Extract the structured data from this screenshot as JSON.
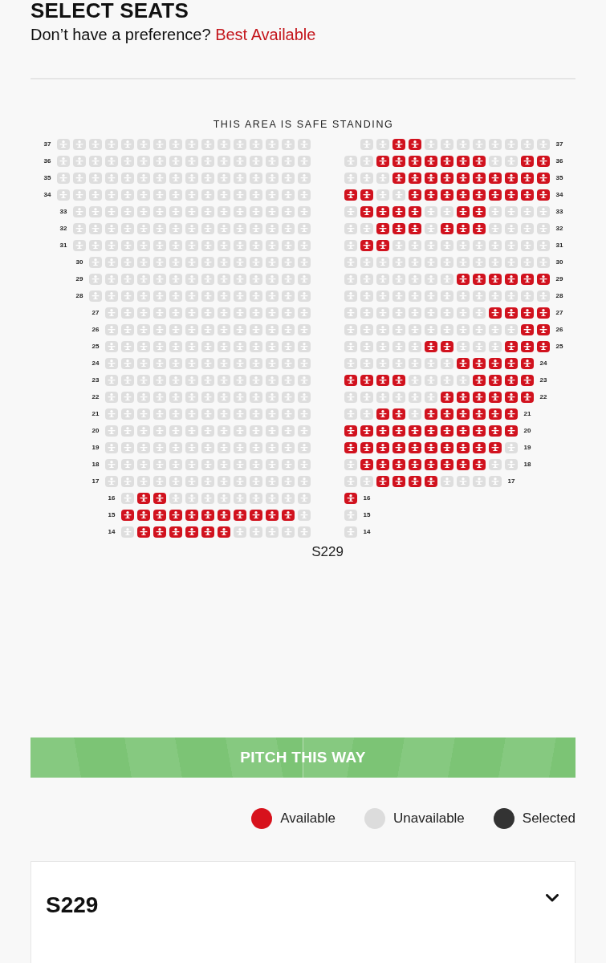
{
  "header": {
    "title": "SELECT SEATS",
    "prompt": "Don’t have a preference?",
    "link": "Best Available"
  },
  "seat_map": {
    "area_note": "THIS AREA IS SAFE STANDING",
    "section_label": "S229",
    "blocks": [
      {
        "kind": "left",
        "rows": [
          {
            "label": "37",
            "available": [
              false,
              false,
              false,
              false,
              false,
              false,
              false,
              false,
              false,
              false,
              false,
              false,
              false,
              false,
              false,
              false
            ]
          },
          {
            "label": "36",
            "available": [
              false,
              false,
              false,
              false,
              false,
              false,
              false,
              false,
              false,
              false,
              false,
              false,
              false,
              false,
              false,
              false
            ]
          },
          {
            "label": "35",
            "available": [
              false,
              false,
              false,
              false,
              false,
              false,
              false,
              false,
              false,
              false,
              false,
              false,
              false,
              false,
              false,
              false
            ]
          },
          {
            "label": "34",
            "available": [
              false,
              false,
              false,
              false,
              false,
              false,
              false,
              false,
              false,
              false,
              false,
              false,
              false,
              false,
              false,
              false
            ]
          },
          {
            "label": "33",
            "available": [
              false,
              false,
              false,
              false,
              false,
              false,
              false,
              false,
              false,
              false,
              false,
              false,
              false,
              false,
              false
            ]
          },
          {
            "label": "32",
            "available": [
              false,
              false,
              false,
              false,
              false,
              false,
              false,
              false,
              false,
              false,
              false,
              false,
              false,
              false,
              false
            ]
          },
          {
            "label": "31",
            "available": [
              false,
              false,
              false,
              false,
              false,
              false,
              false,
              false,
              false,
              false,
              false,
              false,
              false,
              false,
              false
            ]
          },
          {
            "label": "30",
            "available": [
              false,
              false,
              false,
              false,
              false,
              false,
              false,
              false,
              false,
              false,
              false,
              false,
              false,
              false
            ]
          },
          {
            "label": "29",
            "available": [
              false,
              false,
              false,
              false,
              false,
              false,
              false,
              false,
              false,
              false,
              false,
              false,
              false,
              false
            ]
          },
          {
            "label": "28",
            "available": [
              false,
              false,
              false,
              false,
              false,
              false,
              false,
              false,
              false,
              false,
              false,
              false,
              false,
              false
            ]
          },
          {
            "label": "27",
            "available": [
              false,
              false,
              false,
              false,
              false,
              false,
              false,
              false,
              false,
              false,
              false,
              false,
              false
            ]
          },
          {
            "label": "26",
            "available": [
              false,
              false,
              false,
              false,
              false,
              false,
              false,
              false,
              false,
              false,
              false,
              false,
              false
            ]
          },
          {
            "label": "25",
            "available": [
              false,
              false,
              false,
              false,
              false,
              false,
              false,
              false,
              false,
              false,
              false,
              false,
              false
            ]
          },
          {
            "label": "24",
            "available": [
              false,
              false,
              false,
              false,
              false,
              false,
              false,
              false,
              false,
              false,
              false,
              false,
              false
            ]
          },
          {
            "label": "23",
            "available": [
              false,
              false,
              false,
              false,
              false,
              false,
              false,
              false,
              false,
              false,
              false,
              false,
              false
            ]
          },
          {
            "label": "22",
            "available": [
              false,
              false,
              false,
              false,
              false,
              false,
              false,
              false,
              false,
              false,
              false,
              false,
              false
            ]
          },
          {
            "label": "21",
            "available": [
              false,
              false,
              false,
              false,
              false,
              false,
              false,
              false,
              false,
              false,
              false,
              false,
              false
            ]
          },
          {
            "label": "20",
            "available": [
              false,
              false,
              false,
              false,
              false,
              false,
              false,
              false,
              false,
              false,
              false,
              false,
              false
            ]
          },
          {
            "label": "19",
            "available": [
              false,
              false,
              false,
              false,
              false,
              false,
              false,
              false,
              false,
              false,
              false,
              false,
              false
            ]
          },
          {
            "label": "18",
            "available": [
              false,
              false,
              false,
              false,
              false,
              false,
              false,
              false,
              false,
              false,
              false,
              false,
              false
            ]
          },
          {
            "label": "17",
            "available": [
              false,
              false,
              false,
              false,
              false,
              false,
              false,
              false,
              false,
              false,
              false,
              false,
              false
            ]
          },
          {
            "label": "16",
            "available": [
              false,
              true,
              true,
              false,
              false,
              false,
              false,
              false,
              false,
              false,
              false,
              false
            ]
          },
          {
            "label": "15",
            "available": [
              true,
              true,
              true,
              true,
              true,
              true,
              true,
              true,
              true,
              true,
              true,
              false
            ]
          },
          {
            "label": "14",
            "available": [
              false,
              true,
              true,
              true,
              true,
              true,
              true,
              false,
              false,
              false,
              false,
              false
            ]
          }
        ]
      },
      {
        "kind": "right",
        "rows": [
          {
            "label": "37",
            "kind": "outer",
            "available": [
              false,
              false,
              true,
              true,
              false,
              false,
              false,
              false,
              false,
              false,
              false,
              false
            ]
          },
          {
            "label": "36",
            "kind": "aisle",
            "available": [
              false,
              false,
              true,
              true,
              true,
              true,
              true,
              true,
              true,
              false,
              false,
              true,
              true
            ]
          },
          {
            "label": "35",
            "kind": "aisle",
            "available": [
              false,
              false,
              false,
              true,
              true,
              true,
              true,
              true,
              true,
              true,
              true,
              true,
              true
            ]
          },
          {
            "label": "34",
            "kind": "aisle",
            "available": [
              true,
              true,
              false,
              false,
              true,
              true,
              true,
              true,
              true,
              true,
              true,
              true,
              true
            ]
          },
          {
            "label": "33",
            "kind": "aisle",
            "available": [
              false,
              true,
              true,
              true,
              true,
              false,
              false,
              true,
              true,
              false,
              false,
              false,
              false
            ]
          },
          {
            "label": "32",
            "kind": "aisle",
            "available": [
              false,
              false,
              true,
              true,
              true,
              false,
              true,
              true,
              true,
              false,
              false,
              false,
              false
            ]
          },
          {
            "label": "31",
            "kind": "aisle",
            "available": [
              false,
              true,
              true,
              false,
              false,
              false,
              false,
              false,
              false,
              false,
              false,
              false,
              false
            ]
          },
          {
            "label": "30",
            "kind": "aisle",
            "available": [
              false,
              false,
              false,
              false,
              false,
              false,
              false,
              false,
              false,
              false,
              false,
              false,
              false
            ]
          },
          {
            "label": "29",
            "kind": "aisle",
            "available": [
              false,
              false,
              false,
              false,
              false,
              false,
              false,
              true,
              true,
              true,
              true,
              true,
              true
            ]
          },
          {
            "label": "28",
            "kind": "aisle",
            "available": [
              false,
              false,
              false,
              false,
              false,
              false,
              false,
              false,
              false,
              false,
              false,
              false,
              false
            ]
          },
          {
            "label": "27",
            "kind": "aisle",
            "available": [
              false,
              false,
              false,
              false,
              false,
              false,
              false,
              false,
              false,
              true,
              true,
              true,
              true
            ]
          },
          {
            "label": "26",
            "kind": "aisle",
            "available": [
              false,
              false,
              false,
              false,
              false,
              false,
              false,
              false,
              false,
              false,
              false,
              true,
              true
            ]
          },
          {
            "label": "25",
            "kind": "aisle",
            "available": [
              false,
              false,
              false,
              false,
              false,
              true,
              true,
              false,
              false,
              false,
              true,
              true,
              true
            ]
          },
          {
            "label": "24",
            "kind": "aisle",
            "available": [
              false,
              false,
              false,
              false,
              false,
              false,
              false,
              true,
              true,
              true,
              true,
              true
            ]
          },
          {
            "label": "23",
            "kind": "aisle",
            "available": [
              true,
              true,
              true,
              true,
              false,
              false,
              false,
              false,
              true,
              true,
              true,
              true
            ]
          },
          {
            "label": "22",
            "kind": "aisle",
            "available": [
              false,
              false,
              false,
              false,
              false,
              false,
              true,
              true,
              true,
              true,
              true,
              true
            ]
          },
          {
            "label": "21",
            "kind": "aisle",
            "available": [
              false,
              false,
              true,
              true,
              false,
              true,
              true,
              true,
              true,
              true,
              true
            ]
          },
          {
            "label": "20",
            "kind": "aisle",
            "available": [
              true,
              true,
              true,
              true,
              true,
              true,
              true,
              true,
              true,
              true,
              true
            ]
          },
          {
            "label": "19",
            "kind": "aisle",
            "available": [
              true,
              true,
              true,
              true,
              true,
              true,
              true,
              true,
              true,
              true,
              false
            ]
          },
          {
            "label": "18",
            "kind": "aisle",
            "available": [
              false,
              true,
              true,
              true,
              true,
              true,
              true,
              true,
              true,
              false,
              false
            ]
          },
          {
            "label": "17",
            "kind": "aisle",
            "available": [
              false,
              false,
              true,
              true,
              true,
              true,
              false,
              false,
              false,
              false
            ]
          },
          {
            "label": "16",
            "kind": "aisle",
            "available": [
              true
            ]
          },
          {
            "label": "15",
            "kind": "aisle",
            "available": [
              false
            ]
          },
          {
            "label": "14",
            "kind": "aisle",
            "available": [
              false
            ]
          }
        ]
      }
    ]
  },
  "pitch_banner": "PITCH THIS WAY",
  "legend": [
    {
      "label": "Available",
      "color": "#d7121c"
    },
    {
      "label": "Unavailable",
      "color": "#dcdcdc"
    },
    {
      "label": "Selected",
      "color": "#333333"
    }
  ],
  "section_card": {
    "title": "S229",
    "expanded": false
  }
}
